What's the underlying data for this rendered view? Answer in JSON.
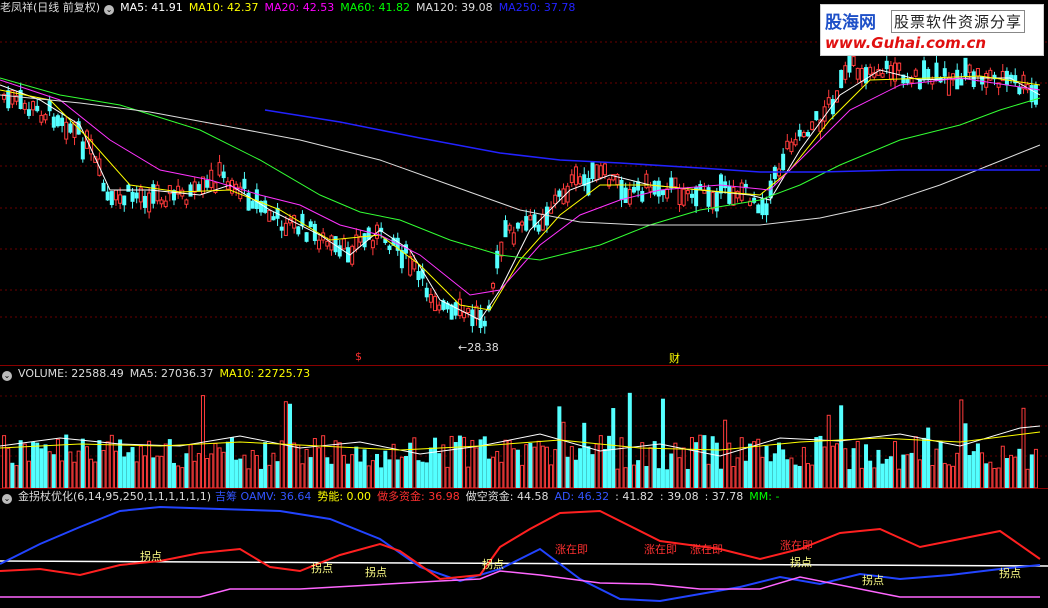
{
  "main": {
    "title": "老凤祥(日线 前复权)",
    "ma": [
      {
        "label": "MA5: 41.91",
        "color": "#ffffff"
      },
      {
        "label": "MA10: 42.37",
        "color": "#ffff00"
      },
      {
        "label": "MA20: 42.53",
        "color": "#ff00ff"
      },
      {
        "label": "MA60: 41.82",
        "color": "#00ff00"
      },
      {
        "label": "MA120: 39.08",
        "color": "#dddddd"
      },
      {
        "label": "MA250: 37.78",
        "color": "#2222ff"
      }
    ],
    "low_marker": "28.38",
    "event_marker_1": "$",
    "event_marker_2": "财"
  },
  "volume": {
    "label": "VOLUME: 22588.49",
    "ma5": "MA5: 27036.37",
    "ma10": "MA10: 22725.73"
  },
  "indicator": {
    "title": "金拐杖优化(6,14,95,250,1,1,1,1,1,1)",
    "items": [
      {
        "label": "吉筹 OAMV: 36.64",
        "color": "#3355ff"
      },
      {
        "label": "势能: 0.00",
        "color": "#ffff00"
      },
      {
        "label": "做多资金: 36.98",
        "color": "#ff3030"
      },
      {
        "label": "做空资金: 44.58",
        "color": "#dddddd"
      },
      {
        "label": "AD: 46.32",
        "color": "#3355ff"
      },
      {
        "label": ": 41.82",
        "color": "#dddddd"
      },
      {
        "label": ": 39.08",
        "color": "#dddddd"
      },
      {
        "label": ": 37.78",
        "color": "#dddddd"
      },
      {
        "label": "MM: -",
        "color": "#00ff00"
      }
    ],
    "guai_label": "拐点",
    "zhang_label": "涨在即"
  },
  "watermark": {
    "brand": "股海网",
    "slogan": "股票软件资源分享",
    "url": "www.Guhai.com.cn"
  }
}
